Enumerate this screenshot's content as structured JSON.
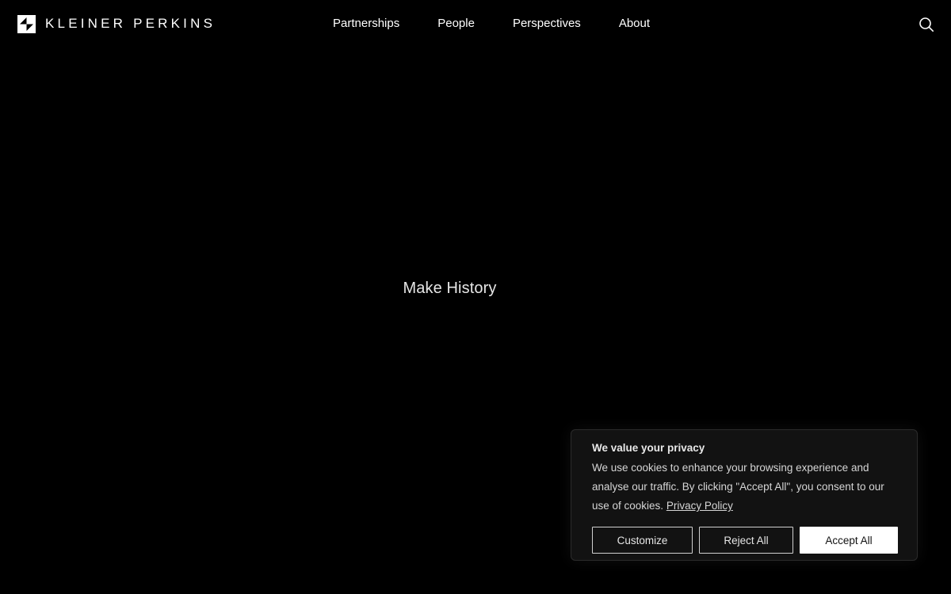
{
  "header": {
    "brand": "KLEINER PERKINS",
    "logo_icon": "kleiner-perkins-logo-mark",
    "nav": [
      {
        "label": "Partnerships"
      },
      {
        "label": "People"
      },
      {
        "label": "Perspectives"
      },
      {
        "label": "About"
      }
    ],
    "search_icon": "search-icon"
  },
  "hero": {
    "title": "Make History"
  },
  "cookie_banner": {
    "title": "We value your privacy",
    "body": "We use cookies to enhance your browsing experience and analyse our traffic. By clicking \"Accept All\", you consent to our use of cookies.",
    "link_label": "Privacy Policy",
    "buttons": {
      "customize": "Customize",
      "reject": "Reject All",
      "accept": "Accept All"
    }
  },
  "colors": {
    "background": "#000000",
    "text": "#ffffff",
    "banner_background": "#121212",
    "accept_button_background": "#ffffff"
  }
}
